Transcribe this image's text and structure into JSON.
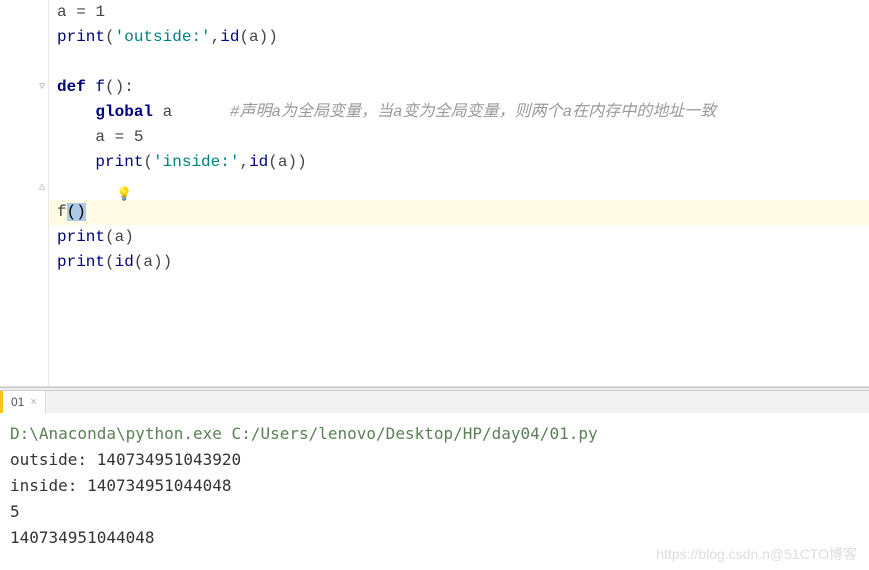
{
  "code": {
    "lines": [
      {
        "indent": "",
        "tokens": [
          {
            "t": "a = ",
            "cls": "ident"
          },
          {
            "t": "1",
            "cls": "num"
          }
        ]
      },
      {
        "indent": "",
        "tokens": [
          {
            "t": "print",
            "cls": "builtin"
          },
          {
            "t": "(",
            "cls": "py-punc"
          },
          {
            "t": "'outside:'",
            "cls": "str"
          },
          {
            "t": ",",
            "cls": "py-punc"
          },
          {
            "t": "id",
            "cls": "builtin"
          },
          {
            "t": "(a))",
            "cls": "py-punc"
          }
        ]
      },
      {
        "indent": "",
        "tokens": []
      },
      {
        "indent": "",
        "tokens": [
          {
            "t": "def ",
            "cls": "kw"
          },
          {
            "t": "f",
            "cls": "fn"
          },
          {
            "t": "():",
            "cls": "py-punc"
          }
        ]
      },
      {
        "indent": "    ",
        "tokens": [
          {
            "t": "global ",
            "cls": "kw"
          },
          {
            "t": "a",
            "cls": "ident"
          },
          {
            "t": "      ",
            "cls": ""
          },
          {
            "t": "#声明a为全局变量，当a变为全局变量，则两个a在内存中的地址一致",
            "cls": "py-comment"
          }
        ]
      },
      {
        "indent": "    ",
        "tokens": [
          {
            "t": "a = ",
            "cls": "ident"
          },
          {
            "t": "5",
            "cls": "num"
          }
        ]
      },
      {
        "indent": "    ",
        "tokens": [
          {
            "t": "print",
            "cls": "builtin"
          },
          {
            "t": "(",
            "cls": "py-punc"
          },
          {
            "t": "'inside:'",
            "cls": "str"
          },
          {
            "t": ",",
            "cls": "py-punc"
          },
          {
            "t": "id",
            "cls": "builtin"
          },
          {
            "t": "(a))",
            "cls": "py-punc"
          }
        ]
      },
      {
        "indent": "",
        "tokens": []
      },
      {
        "indent": "",
        "tokens": [
          {
            "t": "f",
            "cls": "ident"
          },
          {
            "t": "()",
            "cls": "cursor-block"
          }
        ],
        "active": true,
        "bulb": true
      },
      {
        "indent": "",
        "tokens": [
          {
            "t": "print",
            "cls": "builtin"
          },
          {
            "t": "(a)",
            "cls": "py-punc"
          }
        ]
      },
      {
        "indent": "",
        "tokens": [
          {
            "t": "print",
            "cls": "builtin"
          },
          {
            "t": "(",
            "cls": "py-punc"
          },
          {
            "t": "id",
            "cls": "builtin"
          },
          {
            "t": "(a))",
            "cls": "py-punc"
          }
        ]
      }
    ]
  },
  "fold_markers": [
    {
      "row": 3,
      "glyph": "▽"
    },
    {
      "row": 7,
      "glyph": "△"
    }
  ],
  "tab": {
    "label": "01",
    "close": "×"
  },
  "console": {
    "command": "D:\\Anaconda\\python.exe C:/Users/lenovo/Desktop/HP/day04/01.py",
    "lines": [
      "outside: 140734951043920",
      "inside: 140734951044048",
      "5",
      "140734951044048"
    ]
  },
  "watermark": "https://blog.csdn.n@51CTO博客"
}
